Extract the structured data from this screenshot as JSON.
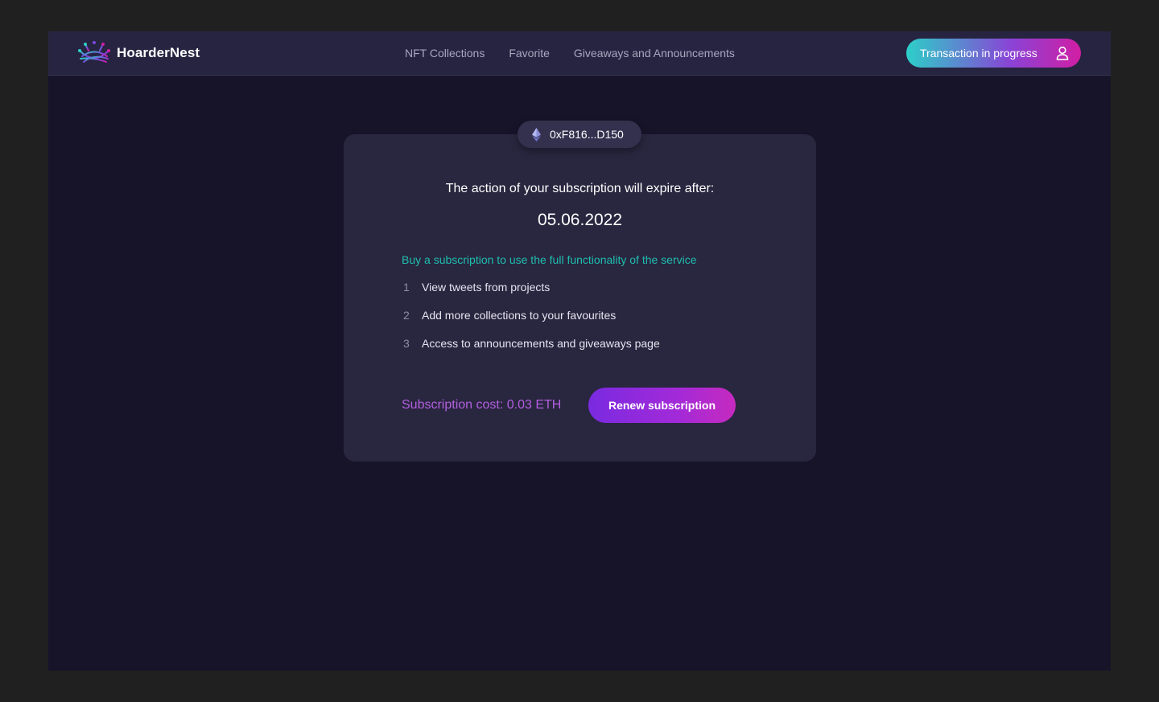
{
  "brand": {
    "name": "HoarderNest",
    "logo_icon": "nest-logo-icon"
  },
  "nav": {
    "links": [
      {
        "label": "NFT Collections"
      },
      {
        "label": "Favorite"
      },
      {
        "label": "Giveaways and Announcements"
      }
    ]
  },
  "account": {
    "status_label": "Transaction in progress",
    "icon": "user-icon"
  },
  "wallet": {
    "address": "0xF816...D150",
    "icon": "ethereum-icon"
  },
  "subscription": {
    "expire_text": "The action of your subscription will expire after:",
    "expire_date": "05.06.2022",
    "cta_text": "Buy a subscription to use the full functionality of the service",
    "features": [
      {
        "num": "1",
        "text": "View tweets from projects"
      },
      {
        "num": "2",
        "text": "Add more collections to your favourites"
      },
      {
        "num": "3",
        "text": "Access to announcements and giveaways page"
      }
    ],
    "cost_label": "Subscription cost: 0.03 ETH",
    "renew_label": "Renew subscription"
  },
  "colors": {
    "accent_teal": "#1ebfae",
    "accent_purple": "#b35fe0",
    "background": "#17142a",
    "card": "#29263f"
  }
}
